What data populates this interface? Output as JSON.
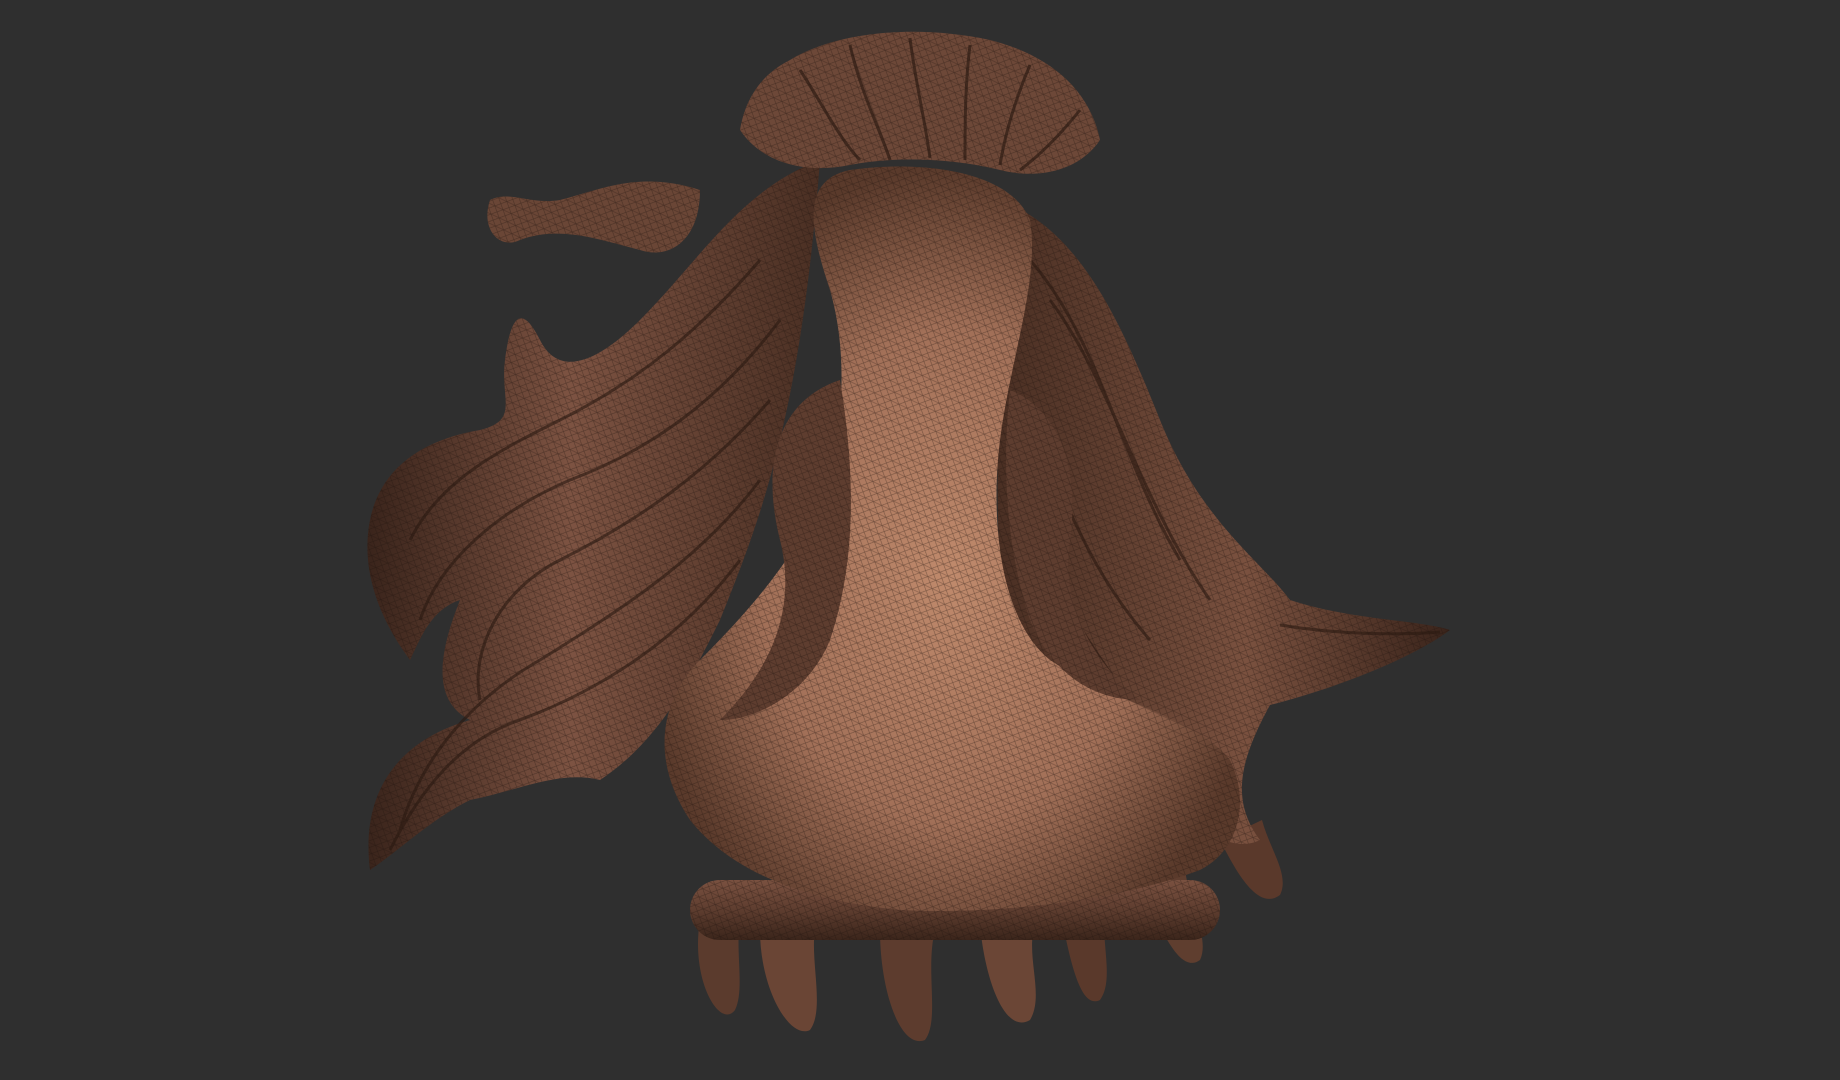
{
  "viewport": {
    "background_color": "#2f2f2f",
    "model": {
      "subject": "sculpted-head-back-view",
      "skin_color": "#b58266",
      "skin_shadow": "#5a3a2b",
      "hair_color": "#6b4535",
      "hair_shadow": "#2e1c15",
      "wire_color": "#1c120d"
    }
  }
}
